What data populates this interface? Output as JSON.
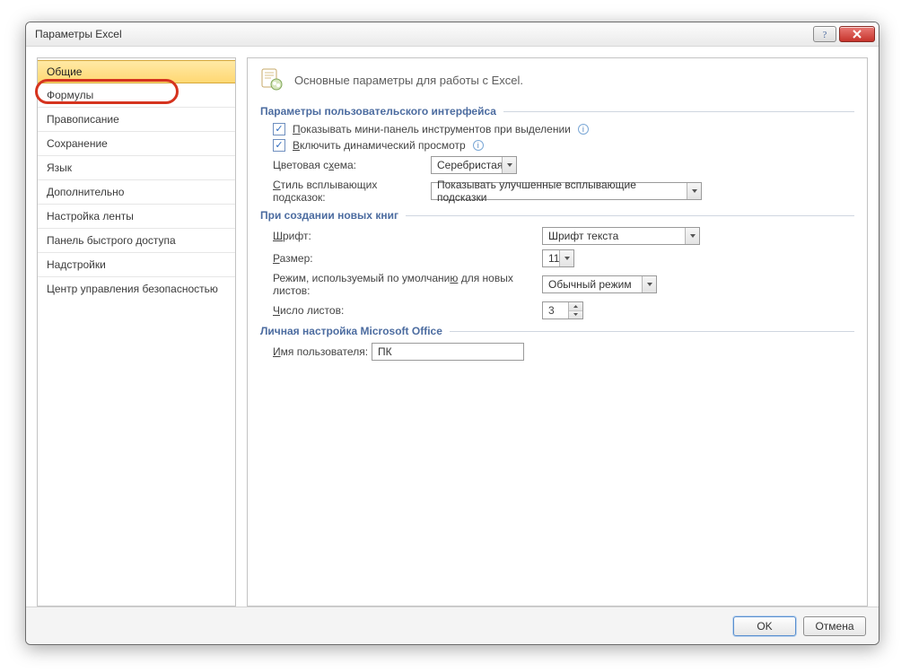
{
  "window": {
    "title": "Параметры Excel"
  },
  "sidebar": {
    "items": [
      {
        "label": "Общие"
      },
      {
        "label": "Формулы"
      },
      {
        "label": "Правописание"
      },
      {
        "label": "Сохранение"
      },
      {
        "label": "Язык"
      },
      {
        "label": "Дополнительно"
      },
      {
        "label": "Настройка ленты"
      },
      {
        "label": "Панель быстрого доступа"
      },
      {
        "label": "Надстройки"
      },
      {
        "label": "Центр управления безопасностью"
      }
    ]
  },
  "panel": {
    "title": "Основные параметры для работы с Excel.",
    "ui_section": {
      "title": "Параметры пользовательского интерфейса",
      "show_minibar": "Показывать мини-панель инструментов при выделении",
      "live_preview": "Включить динамический просмотр",
      "color_scheme_label_pre": "Цветовая с",
      "color_scheme_label_u": "х",
      "color_scheme_label_post": "ема:",
      "color_scheme_value": "Серебристая",
      "tooltip_style_label_u": "С",
      "tooltip_style_label_post": "тиль всплывающих подсказок:",
      "tooltip_style_value": "Показывать улучшенные всплывающие подсказки"
    },
    "newbook_section": {
      "title": "При создании новых книг",
      "font_label_u": "Ш",
      "font_label_post": "рифт:",
      "font_value": "Шрифт текста",
      "size_label_u": "Р",
      "size_label_post": "азмер:",
      "size_value": "11",
      "view_label_pre": "Режим, используемый по умолчани",
      "view_label_u": "ю",
      "view_label_post": " для новых листов:",
      "view_value": "Обычный режим",
      "sheets_label_u": "Ч",
      "sheets_label_post": "исло листов:",
      "sheets_value": "3"
    },
    "personal_section": {
      "title": "Личная настройка Microsoft Office",
      "username_label_u": "И",
      "username_label_post": "мя пользователя:",
      "username_value": "ПК"
    }
  },
  "footer": {
    "ok": "OK",
    "cancel": "Отмена"
  }
}
